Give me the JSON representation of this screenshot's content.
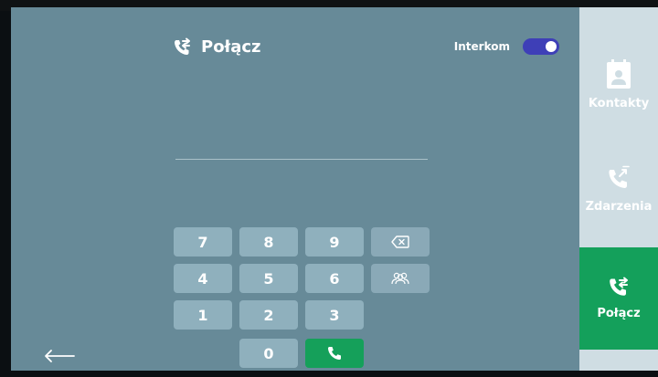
{
  "header": {
    "title": "Połącz",
    "title_icon": "call-forward-icon"
  },
  "interkom": {
    "label": "Interkom",
    "enabled": true
  },
  "keypad": {
    "keys": [
      "7",
      "8",
      "9",
      "4",
      "5",
      "6",
      "1",
      "2",
      "3",
      "0"
    ],
    "backspace_icon": "backspace-icon",
    "contacts_icon": "group-icon",
    "call_icon": "phone-icon"
  },
  "footer": {
    "back_icon": "arrow-left-icon"
  },
  "sidebar": {
    "items": [
      {
        "label": "Kontakty",
        "icon": "contact-card-icon",
        "active": false
      },
      {
        "label": "Zdarzenia",
        "icon": "call-log-icon",
        "active": false
      },
      {
        "label": "Połącz",
        "icon": "call-forward-icon",
        "active": true
      }
    ]
  },
  "colors": {
    "panel_bg": "#678a98",
    "key_bg": "#8fb0bd",
    "accent_green": "#14a05b",
    "toggle_blue": "#3e3fb7",
    "sidebar_bg": "#cfdde3"
  }
}
